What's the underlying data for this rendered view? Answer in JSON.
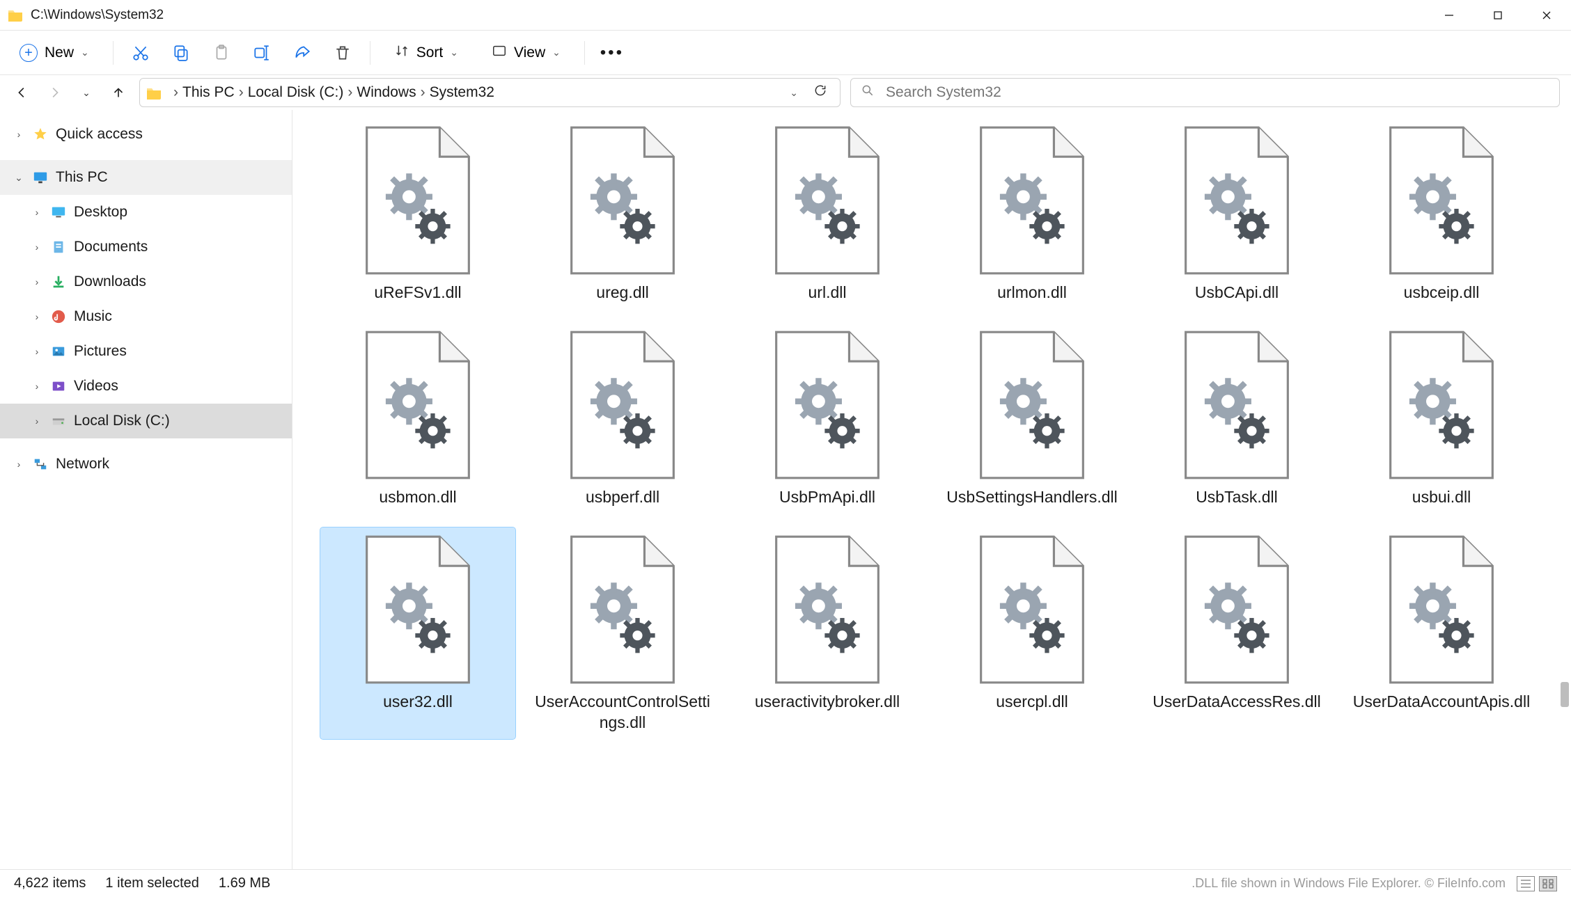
{
  "window": {
    "title": "C:\\Windows\\System32"
  },
  "toolbar": {
    "new_label": "New",
    "sort_label": "Sort",
    "view_label": "View"
  },
  "breadcrumb": {
    "parts": [
      "This PC",
      "Local Disk (C:)",
      "Windows",
      "System32"
    ]
  },
  "search": {
    "placeholder": "Search System32"
  },
  "sidebar": {
    "items": [
      {
        "label": "Quick access",
        "icon": "star",
        "expander": "›",
        "indent": 0,
        "state": ""
      },
      {
        "label": "This PC",
        "icon": "monitor",
        "expander": "⌄",
        "indent": 0,
        "state": "hov"
      },
      {
        "label": "Desktop",
        "icon": "desktop",
        "expander": "›",
        "indent": 1,
        "state": ""
      },
      {
        "label": "Documents",
        "icon": "doc",
        "expander": "›",
        "indent": 1,
        "state": ""
      },
      {
        "label": "Downloads",
        "icon": "download",
        "expander": "›",
        "indent": 1,
        "state": ""
      },
      {
        "label": "Music",
        "icon": "music",
        "expander": "›",
        "indent": 1,
        "state": ""
      },
      {
        "label": "Pictures",
        "icon": "picture",
        "expander": "›",
        "indent": 1,
        "state": ""
      },
      {
        "label": "Videos",
        "icon": "video",
        "expander": "›",
        "indent": 1,
        "state": ""
      },
      {
        "label": "Local Disk (C:)",
        "icon": "disk",
        "expander": "›",
        "indent": 1,
        "state": "sel"
      },
      {
        "label": "Network",
        "icon": "network",
        "expander": "›",
        "indent": 0,
        "state": ""
      }
    ]
  },
  "files": [
    {
      "name": "uReFSv1.dll"
    },
    {
      "name": "ureg.dll"
    },
    {
      "name": "url.dll"
    },
    {
      "name": "urlmon.dll"
    },
    {
      "name": "UsbCApi.dll"
    },
    {
      "name": "usbceip.dll"
    },
    {
      "name": "usbmon.dll"
    },
    {
      "name": "usbperf.dll"
    },
    {
      "name": "UsbPmApi.dll"
    },
    {
      "name": "UsbSettingsHandlers.dll"
    },
    {
      "name": "UsbTask.dll"
    },
    {
      "name": "usbui.dll"
    },
    {
      "name": "user32.dll",
      "selected": true
    },
    {
      "name": "UserAccountControlSettings.dll"
    },
    {
      "name": "useractivitybroker.dll"
    },
    {
      "name": "usercpl.dll"
    },
    {
      "name": "UserDataAccessRes.dll"
    },
    {
      "name": "UserDataAccountApis.dll"
    }
  ],
  "status": {
    "item_count": "4,622 items",
    "selection": "1 item selected",
    "size": "1.69 MB",
    "attribution": ".DLL file shown in Windows File Explorer. © FileInfo.com"
  }
}
